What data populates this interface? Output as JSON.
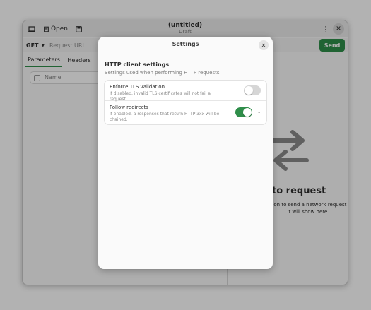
{
  "headerbar": {
    "open_label": "Open",
    "title": "(untitled)",
    "subtitle": "Draft"
  },
  "urlbar": {
    "method": "GET",
    "url_placeholder": "Request URL",
    "send_label": "Send"
  },
  "tabs": [
    {
      "label": "Parameters",
      "active": true
    },
    {
      "label": "Headers",
      "active": false
    }
  ],
  "params": {
    "name_placeholder": "Name"
  },
  "empty_state": {
    "title": "y to request",
    "description": "con to send a network request\nt will show here."
  },
  "dialog": {
    "title": "Settings",
    "section_title": "HTTP client settings",
    "section_desc": "Settings used when performing HTTP requests.",
    "rows": [
      {
        "title": "Enforce TLS validation",
        "subtitle": "If disabled, invalid TLS certificates will not fail a request.",
        "enabled": false
      },
      {
        "title": "Follow redirects",
        "subtitle": "If enabled, a responses that return HTTP 3xx will be chained.",
        "enabled": true
      }
    ]
  },
  "colors": {
    "accent": "#2f8e4a",
    "switch_off": "#d6d6d6"
  }
}
